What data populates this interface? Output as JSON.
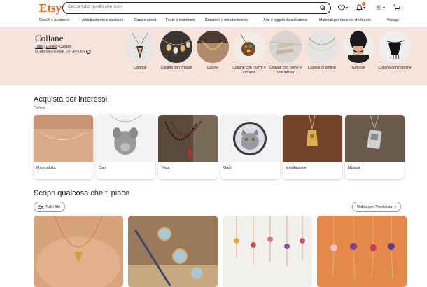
{
  "header": {
    "logo": "Etsy",
    "search_placeholder": "Cerca tutto quello che vuoi",
    "categories": [
      "Gioielli e Accessori",
      "Abbigliamento e calzature",
      "Casa e arredi",
      "Feste e matrimoni",
      "Giocattoli e intrattenimento",
      "Arte e oggetti da collezione",
      "Materiali per creare e strutturare",
      "Vintage"
    ]
  },
  "hero": {
    "title": "Collane",
    "breadcrumb": {
      "home": "Tutto",
      "sep": "›",
      "parent": "Gioielli",
      "current": "Collane"
    },
    "results_text": "(3,380,585 risultati, con Annunci",
    "circles": [
      {
        "label": "Ciondoli"
      },
      {
        "label": "Collane con cristalli"
      },
      {
        "label": "Catene"
      },
      {
        "label": "Collane con charm e ciondoli"
      },
      {
        "label": "Collane con nome e con iniziali"
      },
      {
        "label": "Collane di perline"
      },
      {
        "label": "Girocolli"
      },
      {
        "label": "Collane con nappine"
      }
    ]
  },
  "interests": {
    "title": "Acquista per interessi",
    "subtitle": "Collane",
    "cards": [
      {
        "label": "Minimalista"
      },
      {
        "label": "Cani"
      },
      {
        "label": "Yoga"
      },
      {
        "label": "Gatti"
      },
      {
        "label": "Meditazione"
      },
      {
        "label": "Musica"
      }
    ]
  },
  "discover": {
    "title": "Scopri qualcosa che ti piace",
    "filters_label": "Tutti i filtri",
    "sort_label": "Ordina per: Pertinenza"
  },
  "colors": {
    "brand": "#f1641e",
    "hero_bg": "#f6e3dc"
  }
}
